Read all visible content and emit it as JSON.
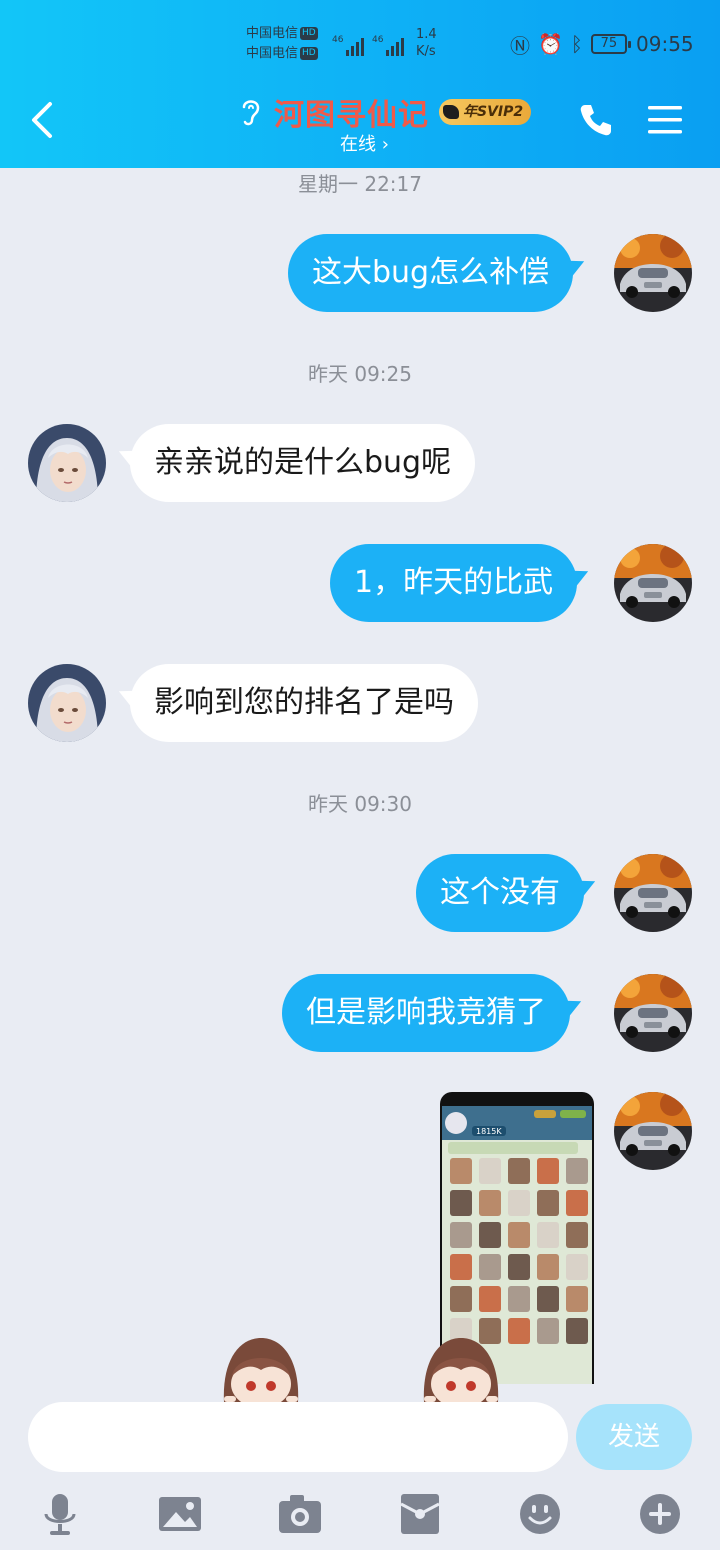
{
  "status_bar": {
    "carrier_1": "中国电信",
    "carrier_2": "中国电信",
    "hd": "HD",
    "net_1": "46",
    "net_2": "46",
    "speed_value": "1.4",
    "speed_unit": "K/s",
    "battery": "75",
    "time": "09:55"
  },
  "header": {
    "title": "河图寻仙记",
    "badge": "年SVIP2",
    "presence": "在线 ›"
  },
  "messages": [
    {
      "type": "timestamp",
      "text": "星期一 22:17"
    },
    {
      "type": "text",
      "from": "me",
      "text": "这大bug怎么补偿"
    },
    {
      "type": "timestamp",
      "text": "昨天 09:25"
    },
    {
      "type": "text",
      "from": "them",
      "text": "亲亲说的是什么bug呢"
    },
    {
      "type": "text",
      "from": "me",
      "text": "1，昨天的比武"
    },
    {
      "type": "text",
      "from": "them",
      "text": "影响到您的排名了是吗"
    },
    {
      "type": "timestamp",
      "text": "昨天 09:30"
    },
    {
      "type": "text",
      "from": "me",
      "text": "这个没有"
    },
    {
      "type": "text",
      "from": "me",
      "text": "但是影响我竞猜了"
    },
    {
      "type": "image",
      "from": "me",
      "caption": "1815K"
    }
  ],
  "input": {
    "value": "",
    "send_label": "发送"
  },
  "toolbar": {
    "icons": [
      "microphone-icon",
      "picture-icon",
      "camera-icon",
      "red-packet-icon",
      "emoji-icon",
      "plus-icon"
    ]
  },
  "colors": {
    "header_start": "#12c6f8",
    "header_end": "#0a9ff2",
    "my_bubble": "#1cb1f6",
    "their_bubble": "#ffffff",
    "background": "#e9ecf3",
    "title": "#ef5a4a",
    "send_button": "#a6e3fb"
  }
}
